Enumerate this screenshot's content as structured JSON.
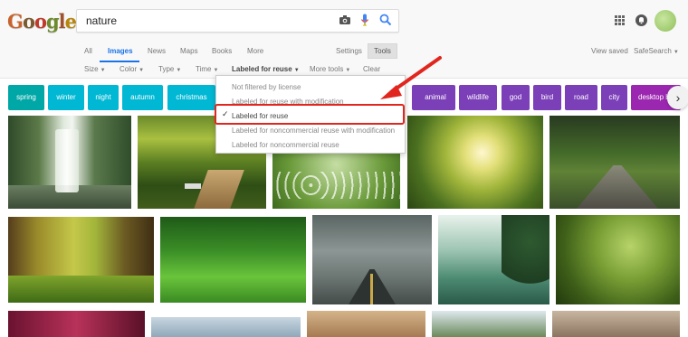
{
  "search": {
    "query": "nature"
  },
  "tabs": [
    {
      "label": "All"
    },
    {
      "label": "Images"
    },
    {
      "label": "News"
    },
    {
      "label": "Maps"
    },
    {
      "label": "Books"
    },
    {
      "label": "More"
    }
  ],
  "toolbar": {
    "settings": "Settings",
    "tools": "Tools",
    "view_saved": "View saved",
    "safesearch": "SafeSearch"
  },
  "filters": [
    {
      "label": "Size"
    },
    {
      "label": "Color"
    },
    {
      "label": "Type"
    },
    {
      "label": "Time"
    },
    {
      "label": "Labeled for reuse"
    },
    {
      "label": "More tools"
    },
    {
      "label": "Clear"
    }
  ],
  "chips": [
    {
      "label": "spring",
      "color": "#00a7a7"
    },
    {
      "label": "winter",
      "color": "#00b8d4"
    },
    {
      "label": "night",
      "color": "#00b8d4"
    },
    {
      "label": "autumn",
      "color": "#00b8d4"
    },
    {
      "label": "christmas",
      "color": "#00b8d4"
    },
    {
      "label": "animal",
      "color": "#7b3fb8"
    },
    {
      "label": "wildlife",
      "color": "#7b3fb8"
    },
    {
      "label": "god",
      "color": "#7b3fb8"
    },
    {
      "label": "bird",
      "color": "#7b3fb8"
    },
    {
      "label": "road",
      "color": "#7b3fb8"
    },
    {
      "label": "city",
      "color": "#7b3fb8"
    },
    {
      "label": "desktop b",
      "color": "#9b27b0"
    }
  ],
  "dropdown": {
    "items": [
      {
        "label": "Not filtered by license",
        "selected": false
      },
      {
        "label": "Labeled for reuse with modification",
        "selected": false
      },
      {
        "label": "Labeled for reuse",
        "selected": true
      },
      {
        "label": "Labeled for noncommercial reuse with modification",
        "selected": false
      },
      {
        "label": "Labeled for noncommercial reuse",
        "selected": false
      }
    ]
  },
  "colors": {
    "accent": "#1a73e8",
    "highlight": "#e0261e"
  }
}
